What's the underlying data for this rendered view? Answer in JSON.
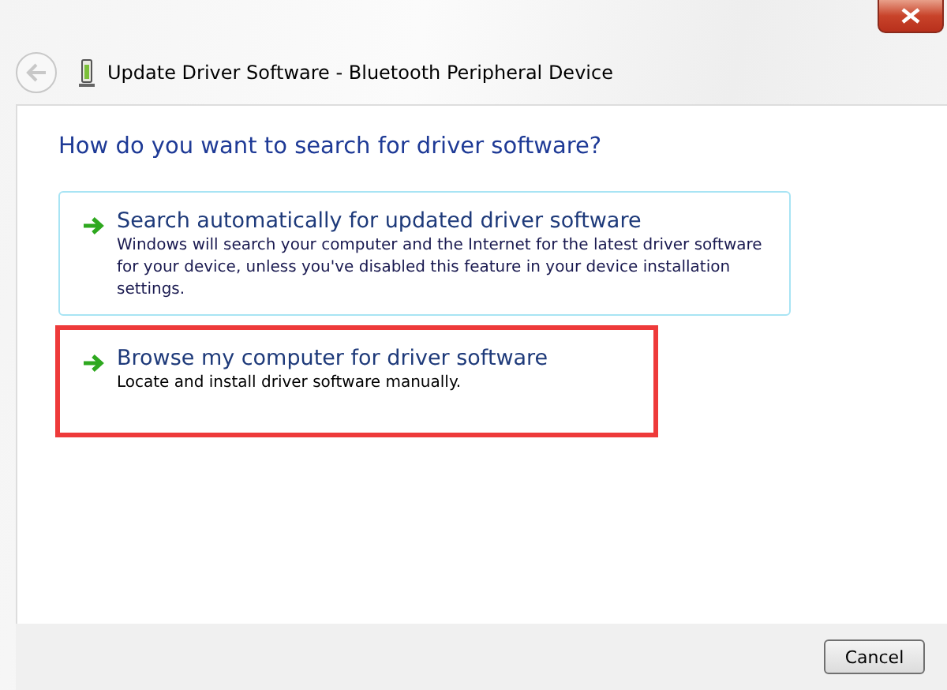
{
  "window": {
    "title": "Update Driver Software - Bluetooth Peripheral Device"
  },
  "heading": "How do you want to search for driver software?",
  "options": [
    {
      "title": "Search automatically for updated driver software",
      "description": "Windows will search your computer and the Internet for the latest driver software for your device, unless you've disabled this feature in your device installation settings.",
      "kind": "hover"
    },
    {
      "title": "Browse my computer for driver software",
      "description": "Locate and install driver software manually.",
      "kind": "highlight"
    }
  ],
  "buttons": [
    "Cancel"
  ]
}
